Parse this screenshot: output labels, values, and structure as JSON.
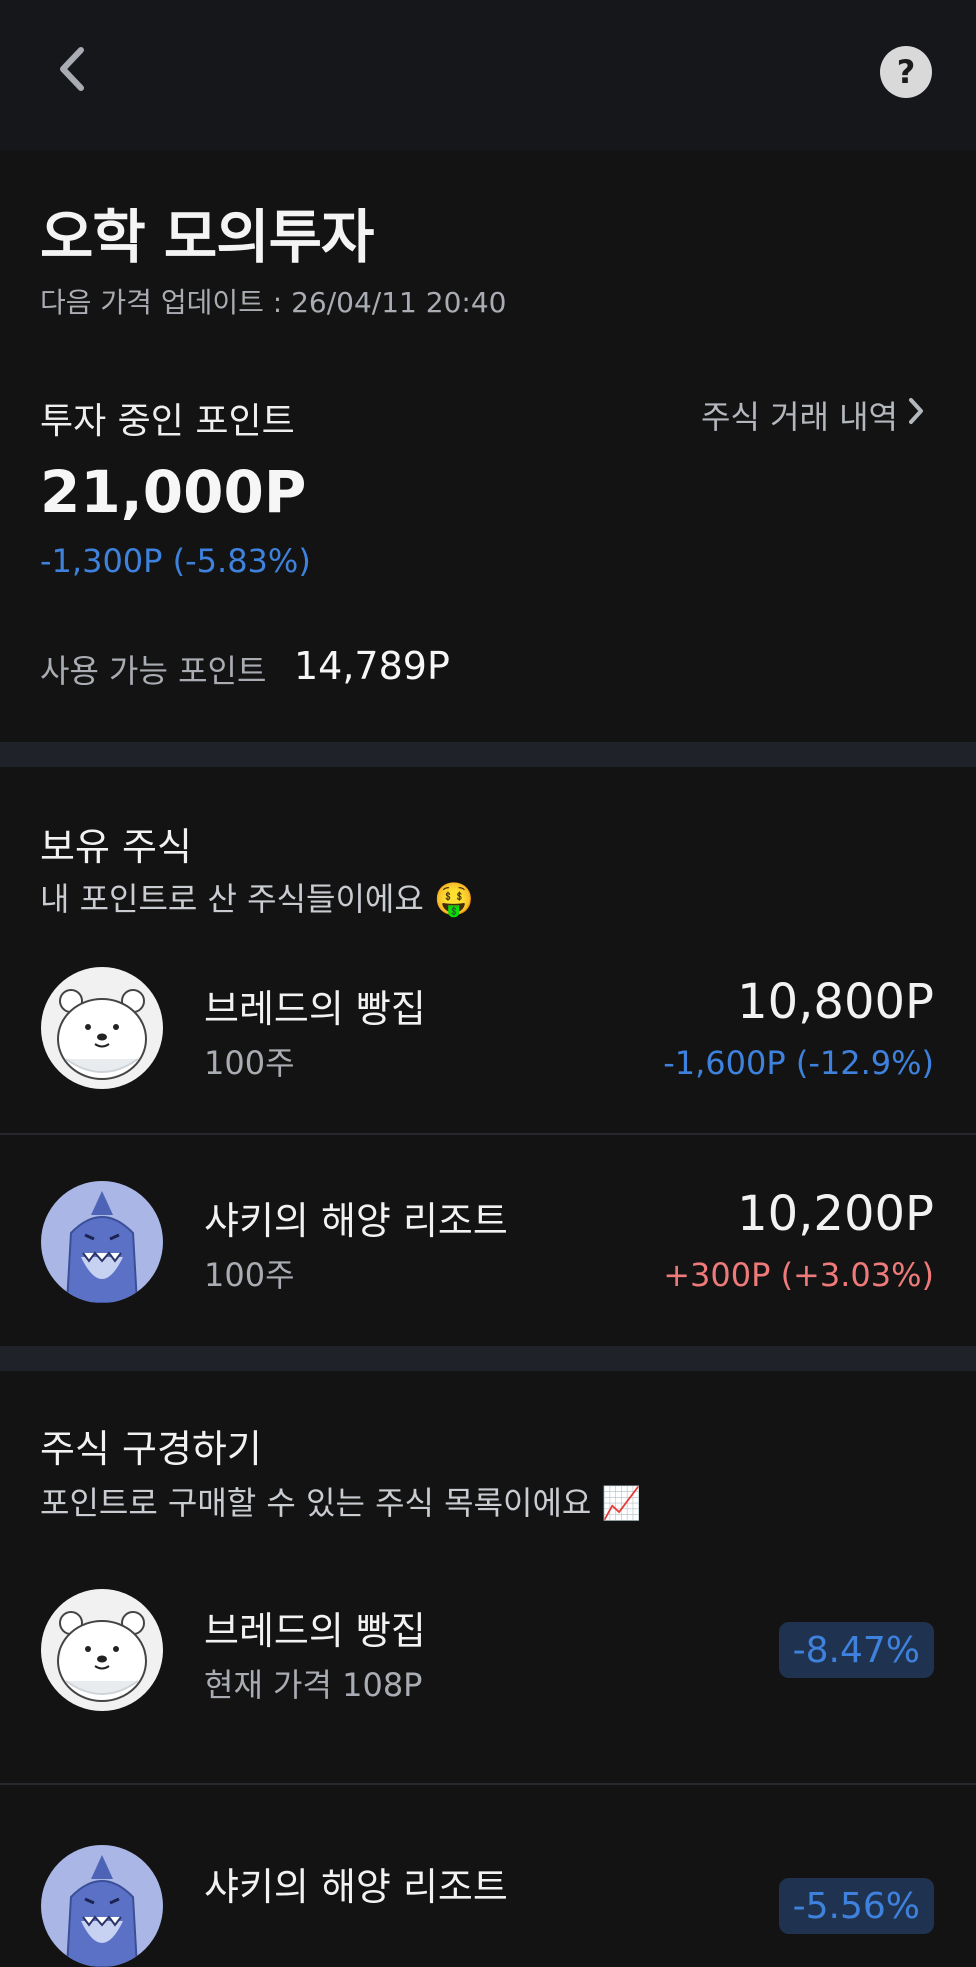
{
  "header": {
    "back_icon": "chevron-left-icon",
    "help_icon": "question-mark-icon",
    "help_label": "?"
  },
  "title": "오학 모의투자",
  "next_update": "다음 가격 업데이트 : 26/04/11 20:40",
  "investment": {
    "label": "투자 중인 포인트",
    "history_link": "주식 거래 내역",
    "value": "21,000P",
    "change": "-1,300P (-5.83%)",
    "available_label": "사용 가능 포인트",
    "available_value": "14,789P"
  },
  "holdings": {
    "title": "보유 주식",
    "subtitle": "내 포인트로 산 주식들이에요 🤑",
    "items": [
      {
        "name": "브레드의 빵집",
        "quantity": "100주",
        "value": "10,800P",
        "change": "-1,600P (-12.9%)",
        "avatar": "polar-bear-avatar"
      },
      {
        "name": "샤키의 해양 리조트",
        "quantity": "100주",
        "value": "10,200P",
        "change": "+300P (+3.03%)",
        "avatar": "shark-avatar"
      }
    ]
  },
  "browse": {
    "title": "주식 구경하기",
    "subtitle": "포인트로 구매할 수 있는 주식 목록이에요 📈",
    "items": [
      {
        "name": "브레드의 빵집",
        "price": "현재 가격 108P",
        "percent": "-8.47%",
        "avatar": "polar-bear-avatar"
      },
      {
        "name": "샤키의 해양 리조트",
        "percent": "-5.56%",
        "avatar": "shark-avatar"
      }
    ]
  },
  "colors": {
    "background": "#131313",
    "divider": "#1f2229",
    "negative": "#3e82dd",
    "positive": "#ef7a7a",
    "badge_bg": "#1f3350"
  }
}
